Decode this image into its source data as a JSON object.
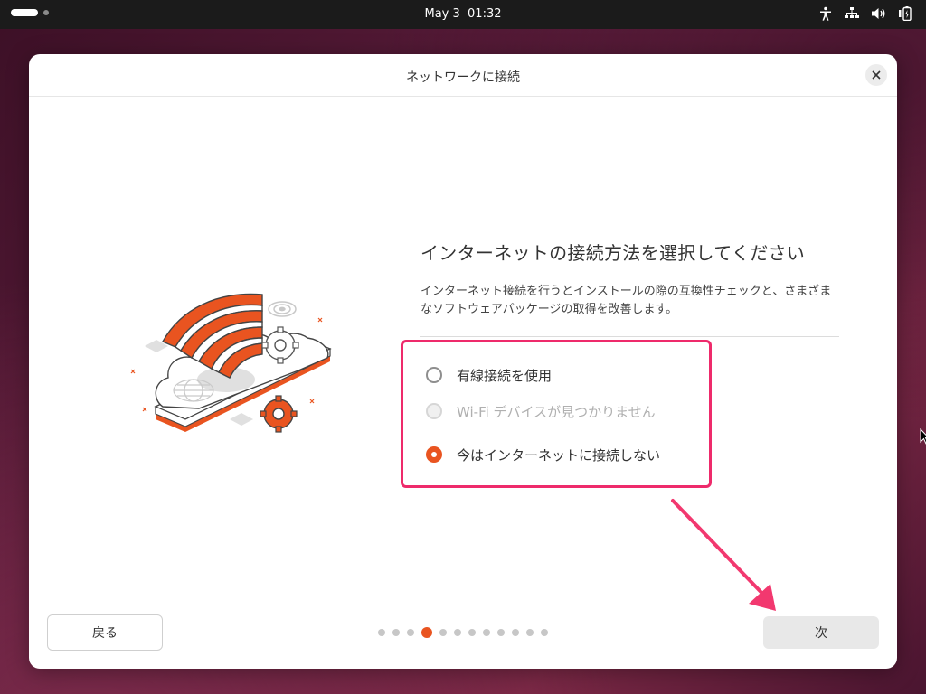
{
  "topbar": {
    "date": "May 3",
    "time": "01:32",
    "icons": [
      "accessibility-icon",
      "network-icon",
      "volume-icon",
      "battery-icon"
    ]
  },
  "dialog": {
    "title": "ネットワークに接続",
    "heading": "インターネットの接続方法を選択してください",
    "description": "インターネット接続を行うとインストールの際の互換性チェックと、さまざまなソフトウェアパッケージの取得を改善します。",
    "options": [
      {
        "label": "有線接続を使用",
        "state": "unselected"
      },
      {
        "label": "Wi-Fi デバイスが見つかりません",
        "state": "disabled"
      },
      {
        "label": "今はインターネットに接続しない",
        "state": "selected"
      }
    ],
    "back_label": "戻る",
    "next_label": "次",
    "pager": {
      "total": 12,
      "current": 4
    }
  },
  "colors": {
    "accent": "#E95420",
    "highlight": "#EE2A6B",
    "topbar": "#1B1B1B"
  }
}
